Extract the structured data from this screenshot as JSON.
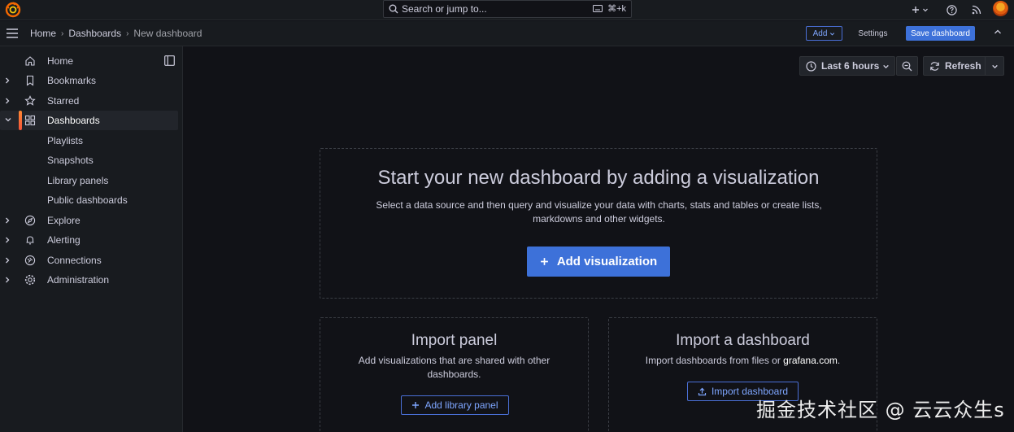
{
  "topbar": {
    "search_placeholder": "Search or jump to...",
    "search_shortcut": "⌘+k"
  },
  "breadcrumb": [
    "Home",
    "Dashboards",
    "New dashboard"
  ],
  "toolbar": {
    "add_label": "Add",
    "settings_label": "Settings",
    "save_label": "Save dashboard"
  },
  "sidebar": {
    "items": [
      {
        "label": "Home",
        "icon": "home-icon",
        "expandable": false
      },
      {
        "label": "Bookmarks",
        "icon": "bookmark-icon",
        "expandable": true
      },
      {
        "label": "Starred",
        "icon": "star-icon",
        "expandable": true
      },
      {
        "label": "Dashboards",
        "icon": "apps-icon",
        "expandable": true,
        "active": true
      },
      {
        "label": "Playlists",
        "sub": true
      },
      {
        "label": "Snapshots",
        "sub": true
      },
      {
        "label": "Library panels",
        "sub": true
      },
      {
        "label": "Public dashboards",
        "sub": true
      },
      {
        "label": "Explore",
        "icon": "compass-icon",
        "expandable": true
      },
      {
        "label": "Alerting",
        "icon": "bell-icon",
        "expandable": true
      },
      {
        "label": "Connections",
        "icon": "plug-icon",
        "expandable": true
      },
      {
        "label": "Administration",
        "icon": "cog-icon",
        "expandable": true
      }
    ]
  },
  "controls": {
    "time_range": "Last 6 hours",
    "refresh_label": "Refresh"
  },
  "empty_state": {
    "title": "Start your new dashboard by adding a visualization",
    "description": "Select a data source and then query and visualize your data with charts, stats and tables or create lists, markdowns and other widgets.",
    "button": "Add visualization"
  },
  "import_panel": {
    "title": "Import panel",
    "description": "Add visualizations that are shared with other dashboards.",
    "button": "Add library panel"
  },
  "import_dashboard": {
    "title": "Import a dashboard",
    "description_prefix": "Import dashboards from files or ",
    "description_link": "grafana.com",
    "description_suffix": ".",
    "button": "Import dashboard"
  },
  "watermark": "掘金技术社区 @ 云云众生s",
  "colors": {
    "accent": "#3d71d9",
    "background": "#111217",
    "panel": "#181b1f",
    "active_bar": "#f5543a"
  }
}
